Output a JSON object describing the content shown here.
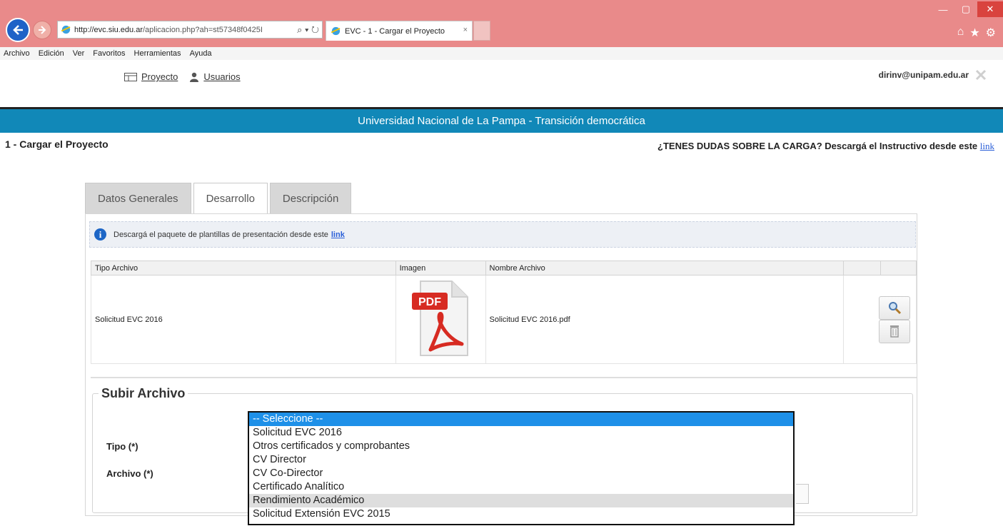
{
  "browser": {
    "url_host": "http://evc.siu.edu.ar",
    "url_path": "/aplicacion.php?ah=st57348f0425I",
    "tab_title": "EVC - 1 - Cargar el Proyecto",
    "tab_close": "×",
    "menu": [
      "Archivo",
      "Edición",
      "Ver",
      "Favoritos",
      "Herramientas",
      "Ayuda"
    ]
  },
  "header": {
    "nav": {
      "proyecto": "Proyecto",
      "usuarios": "Usuarios"
    },
    "user_email": "dirinv@unipam.edu.ar",
    "banner": "Universidad Nacional de La Pampa - Transición democrática"
  },
  "page": {
    "title": "1 - Cargar el Proyecto",
    "help_text": "¿TENES DUDAS SOBRE LA CARGA? Descargá el Instructivo desde este ",
    "help_link": "link"
  },
  "tabs": [
    "Datos Generales",
    "Desarrollo",
    "Descripción"
  ],
  "info": {
    "text": "Descargá el paquete de plantillas de presentación desde este",
    "link": "link"
  },
  "table": {
    "columns": [
      "Tipo Archivo",
      "Imagen",
      "Nombre Archivo",
      "",
      ""
    ],
    "rows": [
      {
        "tipo": "Solicitud EVC 2016",
        "imagen": "PDF",
        "nombre": "Solicitud EVC 2016.pdf"
      }
    ]
  },
  "upload": {
    "legend": "Subir Archivo",
    "tipo_label": "Tipo (*)",
    "archivo_label": "Archivo (*)"
  },
  "dropdown": {
    "options": [
      "-- Seleccione --",
      "Solicitud EVC 2016",
      "Otros certificados y comprobantes",
      "CV Director",
      "CV Co-Director",
      "Certificado Analítico",
      "Rendimiento Académico",
      "Solicitud Extensión EVC 2015"
    ]
  }
}
